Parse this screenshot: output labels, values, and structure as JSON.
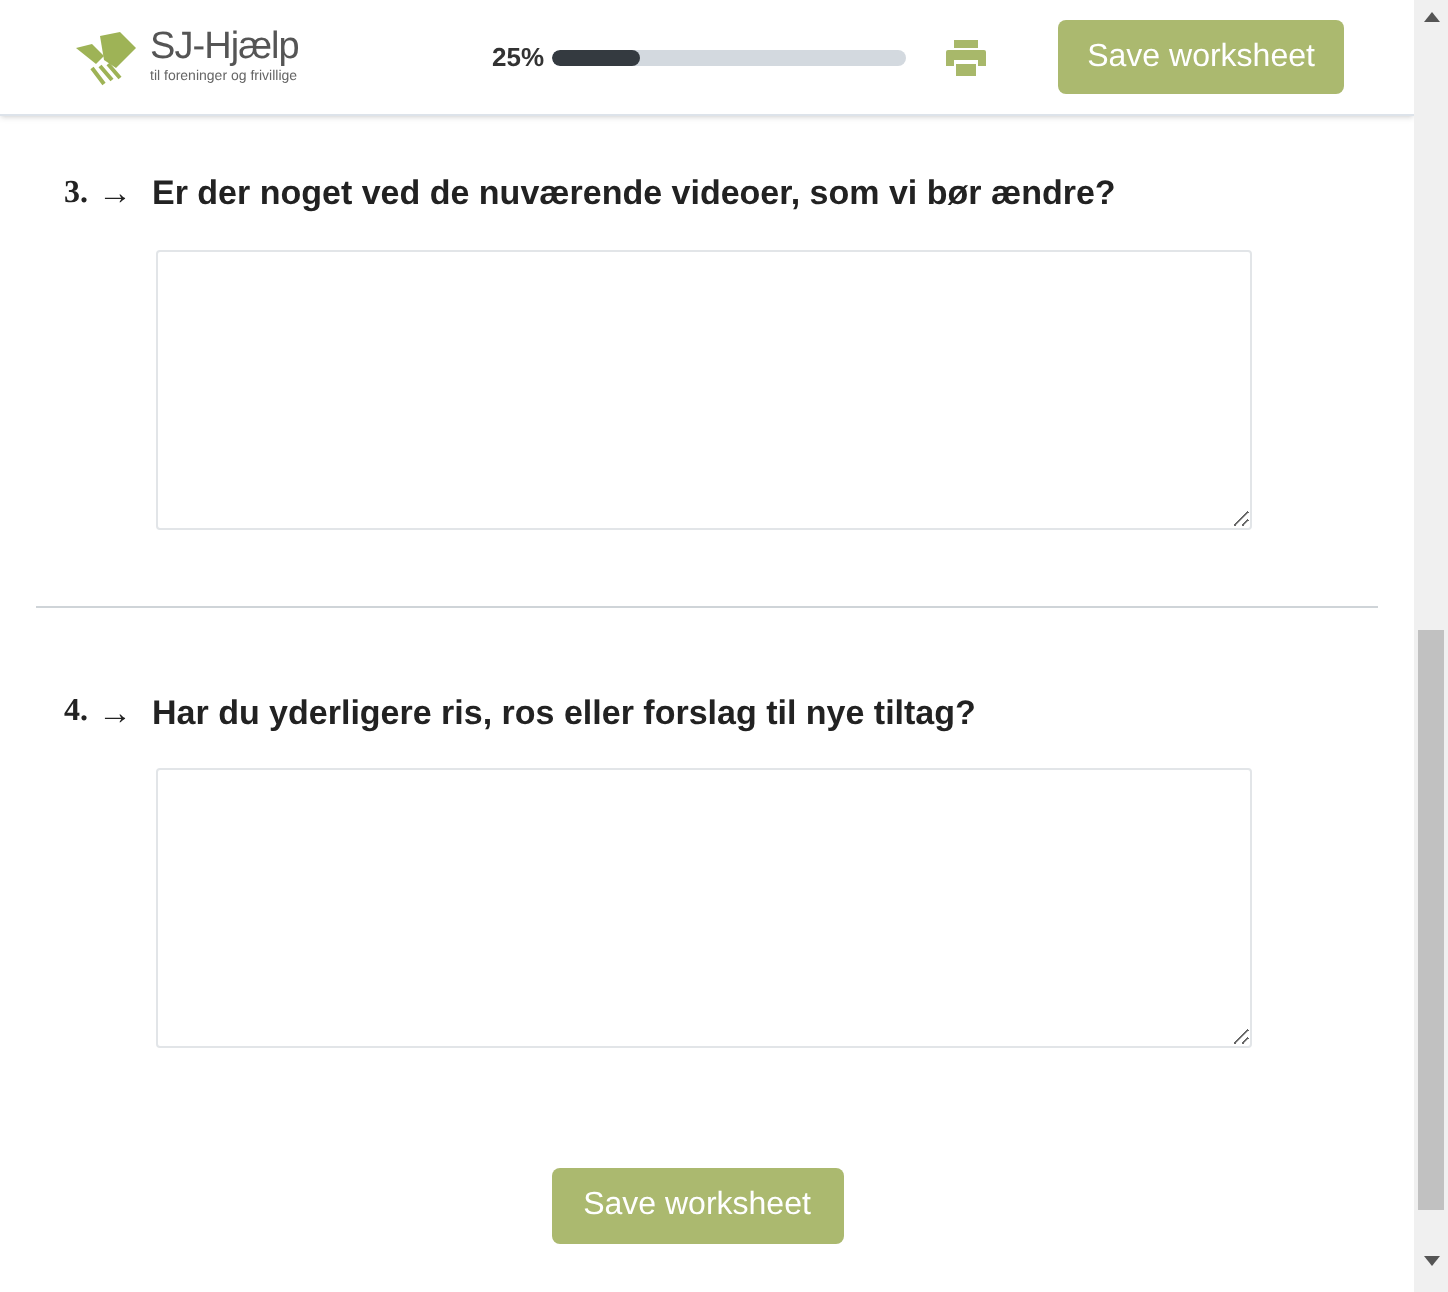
{
  "header": {
    "logo": {
      "title": "SJ-Hjælp",
      "subtitle": "til foreninger og frivillige"
    },
    "progress": {
      "reading": "25%",
      "level": 0.25
    },
    "save_button": "Save worksheet"
  },
  "questions": [
    {
      "number": "3.",
      "arrow": "→",
      "text": "Er der noget ved de nuværende videoer, som vi bør ændre?"
    },
    {
      "number": "4.",
      "arrow": "→",
      "text": "Har du yderligere ris, ros eller forslag til nye tiltag?"
    }
  ],
  "footer_button": "Save worksheet"
}
